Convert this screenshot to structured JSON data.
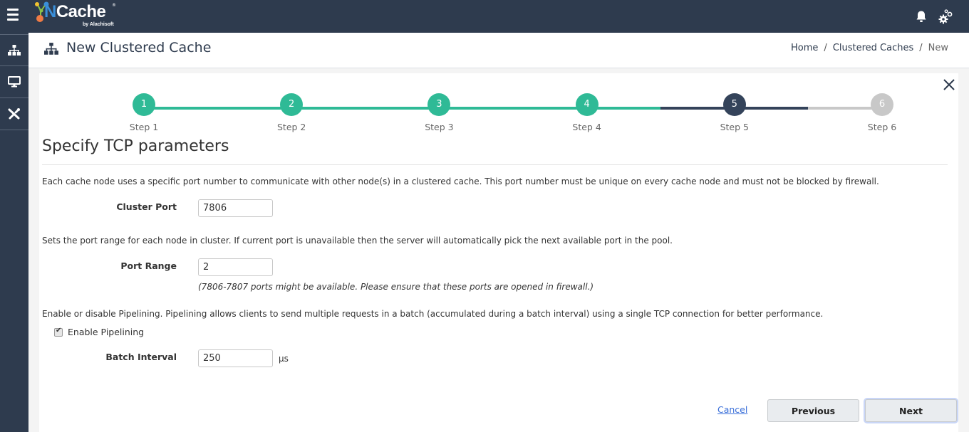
{
  "app": {
    "logo_text_n": "N",
    "logo_text_rest": "Cache",
    "logo_registered": "®",
    "logo_byline": "by Alachisoft"
  },
  "topbar": {
    "icons": [
      "menu-icon",
      "bell-icon",
      "gears-icon"
    ]
  },
  "sidebar": {
    "items": [
      {
        "name": "clustered-caches",
        "icon": "sitemap-icon"
      },
      {
        "name": "monitor",
        "icon": "monitor-icon"
      },
      {
        "name": "tools",
        "icon": "tools-icon"
      }
    ]
  },
  "header": {
    "title": "New Clustered Cache",
    "breadcrumb": [
      "Home",
      "Clustered Caches",
      "New"
    ],
    "breadcrumb_separator": "/"
  },
  "wizard": {
    "colors": {
      "done": "#2fba96",
      "current": "#34435a",
      "pending": "#c8c8c8"
    },
    "current_step": 5,
    "steps": [
      {
        "number": "1",
        "label": "Step 1",
        "state": "done"
      },
      {
        "number": "2",
        "label": "Step 2",
        "state": "done"
      },
      {
        "number": "3",
        "label": "Step 3",
        "state": "done"
      },
      {
        "number": "4",
        "label": "Step 4",
        "state": "done"
      },
      {
        "number": "5",
        "label": "Step 5",
        "state": "current"
      },
      {
        "number": "6",
        "label": "Step 6",
        "state": "pending"
      }
    ],
    "section_title": "Specify TCP parameters",
    "cluster_port": {
      "description": "Each cache node uses a specific port number to communicate with other node(s) in a clustered cache. This port number must be unique on every cache node and must not be blocked by firewall.",
      "label": "Cluster Port",
      "value": "7806"
    },
    "port_range": {
      "description": "Sets the port range for each node in cluster. If current port is unavailable then the server will automatically pick the next available port in the pool.",
      "label": "Port Range",
      "value": "2",
      "hint": "(7806-7807 ports might be available. Please ensure that these ports are opened in firewall.)"
    },
    "pipelining": {
      "description": "Enable or disable Pipelining. Pipelining allows clients to send multiple requests in a batch (accumulated during a batch interval) using a single TCP connection for better performance.",
      "checkbox_label": "Enable Pipelining",
      "checked": true,
      "batch_label": "Batch Interval",
      "batch_value": "250",
      "batch_unit": "µs"
    },
    "actions": {
      "cancel": "Cancel",
      "previous": "Previous",
      "next": "Next"
    }
  }
}
